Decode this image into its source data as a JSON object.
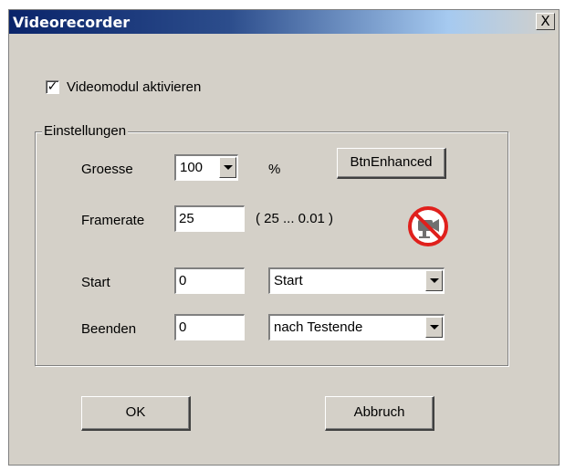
{
  "window": {
    "title": "Videorecorder",
    "close_glyph": "X"
  },
  "videomodul": {
    "checked": true,
    "check_glyph": "✓",
    "label": "Videomodul aktivieren"
  },
  "settings": {
    "group_title": "Einstellungen",
    "size": {
      "label": "Groesse",
      "value": "100",
      "unit": "%"
    },
    "enhanced_button_label": "BtnEnhanced",
    "framerate": {
      "label": "Framerate",
      "value": "25",
      "range": "( 25 ... 0.01 )"
    },
    "no_video_icon": "no-camera-icon",
    "start": {
      "label": "Start",
      "value": "0",
      "mode": "Start"
    },
    "stop": {
      "label": "Beenden",
      "value": "0",
      "mode": "nach Testende"
    }
  },
  "buttons": {
    "ok": "OK",
    "cancel": "Abbruch"
  },
  "colors": {
    "dialog_bg": "#d4d0c8",
    "titlebar_start": "#0a246a",
    "prohibited_red": "#e0201c"
  }
}
